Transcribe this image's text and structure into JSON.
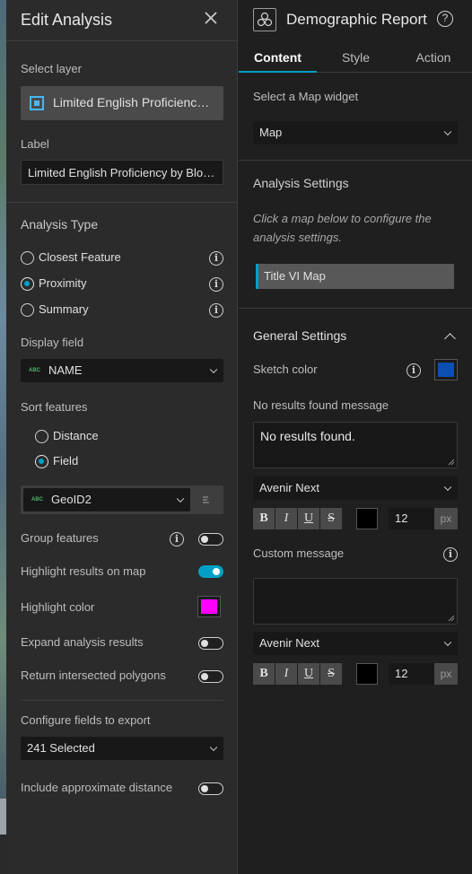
{
  "left_panel": {
    "title": "Edit Analysis",
    "select_layer_label": "Select layer",
    "selected_layer": "Limited English Proficienc…",
    "label_label": "Label",
    "label_value": "Limited English Proficiency by Blo…",
    "analysis_type_label": "Analysis Type",
    "analysis_types": [
      {
        "label": "Closest Feature",
        "selected": false
      },
      {
        "label": "Proximity",
        "selected": true
      },
      {
        "label": "Summary",
        "selected": false
      }
    ],
    "display_field_label": "Display field",
    "display_field_value": "NAME",
    "field_type_badge": "ABC",
    "sort_features_label": "Sort features",
    "sort_options": [
      {
        "label": "Distance",
        "selected": false
      },
      {
        "label": "Field",
        "selected": true
      }
    ],
    "sort_field_value": "GeoID2",
    "group_features_label": "Group features",
    "group_features_on": false,
    "highlight_results_label": "Highlight results on map",
    "highlight_results_on": true,
    "highlight_color_label": "Highlight color",
    "highlight_color": "#ff00ff",
    "expand_results_label": "Expand analysis results",
    "expand_results_on": false,
    "return_polygons_label": "Return intersected polygons",
    "return_polygons_on": false,
    "configure_fields_label": "Configure fields to export",
    "configure_fields_value": "241 Selected",
    "approx_distance_label": "Include approximate distance",
    "approx_distance_on": false
  },
  "right_panel": {
    "title": "Demographic Report",
    "tabs": [
      {
        "label": "Content",
        "active": true
      },
      {
        "label": "Style",
        "active": false
      },
      {
        "label": "Action",
        "active": false
      }
    ],
    "map_widget_label": "Select a Map widget",
    "map_widget_value": "Map",
    "analysis_settings_label": "Analysis Settings",
    "analysis_settings_hint": "Click a map below to configure the analysis settings.",
    "map_item": "Title VI Map",
    "general_settings_label": "General Settings",
    "sketch_color_label": "Sketch color",
    "sketch_color": "#0b4fb0",
    "no_results_label": "No results found message",
    "no_results_value": "No results found.",
    "font_1": "Avenir Next",
    "font_size_1": "12",
    "size_unit": "px",
    "custom_message_label": "Custom message",
    "custom_message_value": "",
    "font_2": "Avenir Next",
    "font_size_2": "12",
    "text_color": "#000000",
    "format_buttons": [
      "B",
      "I",
      "U",
      "S"
    ]
  },
  "colors": {
    "accent": "#00a0c6",
    "panel_bg": "#2b2b2b",
    "right_bg": "#1f1f1f",
    "layer_icon": "#48b6f0"
  }
}
